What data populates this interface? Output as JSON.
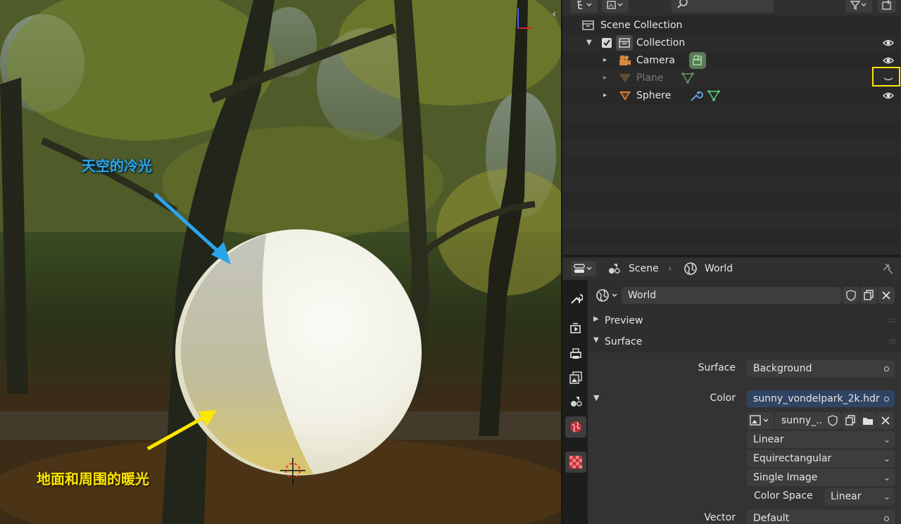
{
  "viewport": {
    "annotation_sky": "天空的冷光",
    "annotation_ground": "地面和周围的暖光",
    "colors": {
      "sky_annotation": "#2aa5ea",
      "ground_annotation": "#ffe600"
    }
  },
  "outliner": {
    "scene_collection": "Scene Collection",
    "items": [
      {
        "label": "Collection",
        "visible": true
      },
      {
        "label": "Camera",
        "visible": true
      },
      {
        "label": "Plane",
        "visible": false
      },
      {
        "label": "Sphere",
        "visible": true
      }
    ]
  },
  "properties": {
    "breadcrumb": {
      "scene": "Scene",
      "world": "World"
    },
    "world_name": "World",
    "panels": {
      "preview": "Preview",
      "surface": "Surface"
    },
    "surface": {
      "surface_label": "Surface",
      "surface_value": "Background",
      "color_label": "Color",
      "color_value": "sunny_vondelpark_2k.hdr",
      "image_name": "sunny_..",
      "interpolation": "Linear",
      "projection": "Equirectangular",
      "source": "Single Image",
      "color_space_label": "Color Space",
      "color_space_value": "Linear",
      "vector_label": "Vector",
      "vector_value": "Default"
    }
  }
}
